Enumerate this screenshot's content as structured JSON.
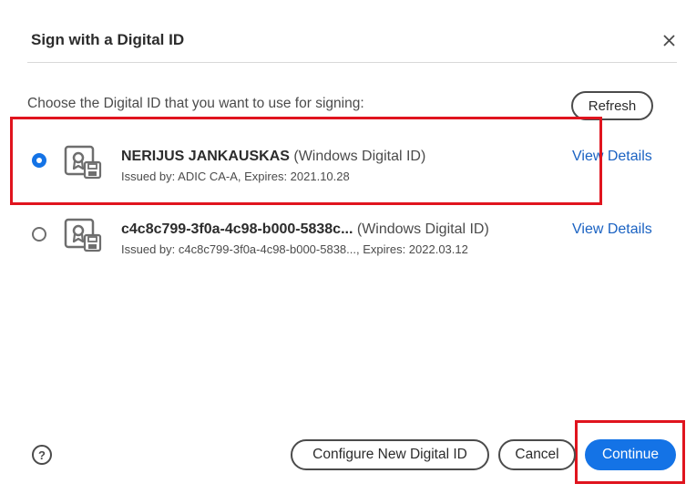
{
  "dialog": {
    "title": "Sign with a Digital ID",
    "close_icon": "close-icon"
  },
  "instruction": "Choose the Digital ID that you want to use for signing:",
  "refresh_label": "Refresh",
  "ids": [
    {
      "name": "NERIJUS JANKAUSKAS",
      "type": "(Windows Digital ID)",
      "issued": "Issued by: ADIC CA-A, Expires: 2021.10.28",
      "view_details": "View Details",
      "selected": true
    },
    {
      "name": "c4c8c799-3f0a-4c98-b000-5838c...",
      "type": "(Windows Digital ID)",
      "issued": "Issued by: c4c8c799-3f0a-4c98-b000-5838..., Expires: 2022.03.12",
      "view_details": "View Details",
      "selected": false
    }
  ],
  "footer": {
    "help_glyph": "?",
    "configure_label": "Configure New Digital ID",
    "cancel_label": "Cancel",
    "continue_label": "Continue"
  },
  "colors": {
    "accent": "#1473e6",
    "link": "#1a62c2",
    "highlight": "#e0141e"
  }
}
